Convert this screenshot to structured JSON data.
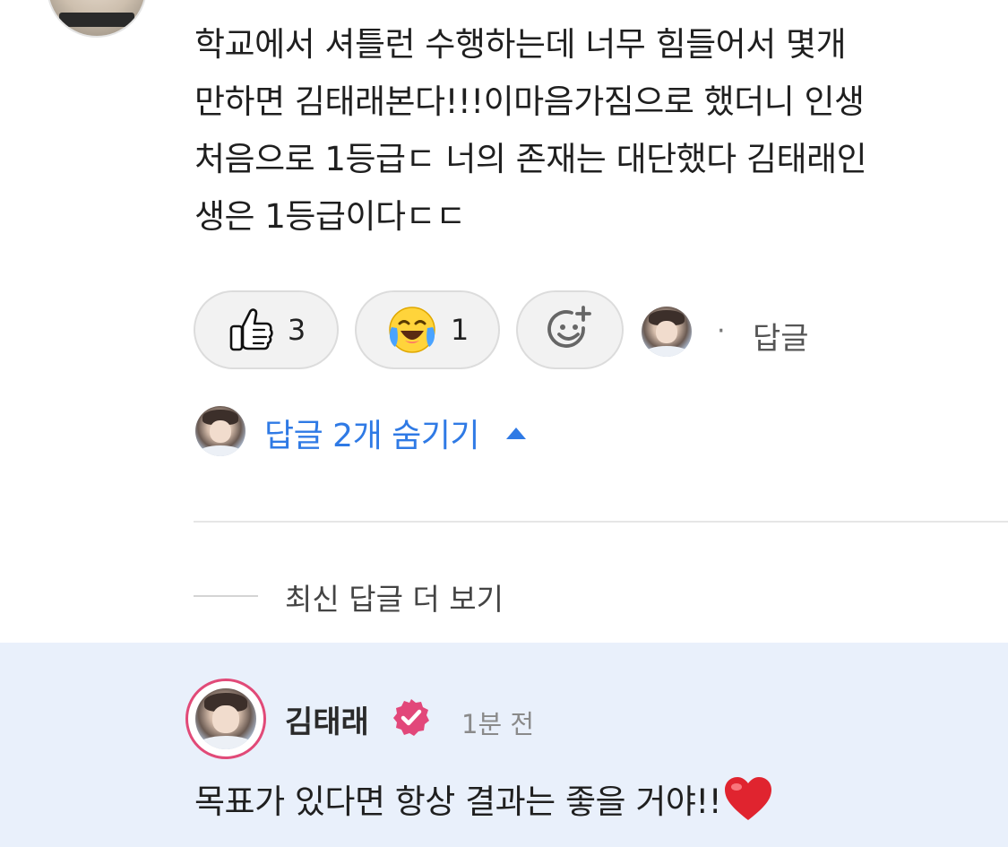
{
  "comment": {
    "text": "학교에서 셔틀런 수행하는데 너무 힘들어서 몇개\n만하면 김태래본다!!!이마음가짐으로 했더니 인생\n처음으로 1등급ㄷ 너의 존재는 대단했다 김태래인\n생은 1등급이다ㄷㄷ"
  },
  "reactions": [
    {
      "icon": "thumbs-up-icon",
      "count": "3"
    },
    {
      "icon": "crying-laughing-icon",
      "count": "1"
    },
    {
      "icon": "add-reaction-icon"
    }
  ],
  "reply_link": "답글",
  "separator": "·",
  "replies_toggle": "답글 2개 숨기기",
  "more_replies": "최신 답글 더 보기",
  "reply": {
    "author": "김태래",
    "verified_icon": "verified-badge-icon",
    "time": "1분 전",
    "text": "목표가 있다면 항상 결과는 좋을 거야!!",
    "heart_icon": "heart-icon"
  },
  "colors": {
    "link_blue": "#2f7ae5",
    "highlight_bg": "#e9f0fb",
    "creator_ring": "#e14a78",
    "verified": "#e2477a"
  }
}
